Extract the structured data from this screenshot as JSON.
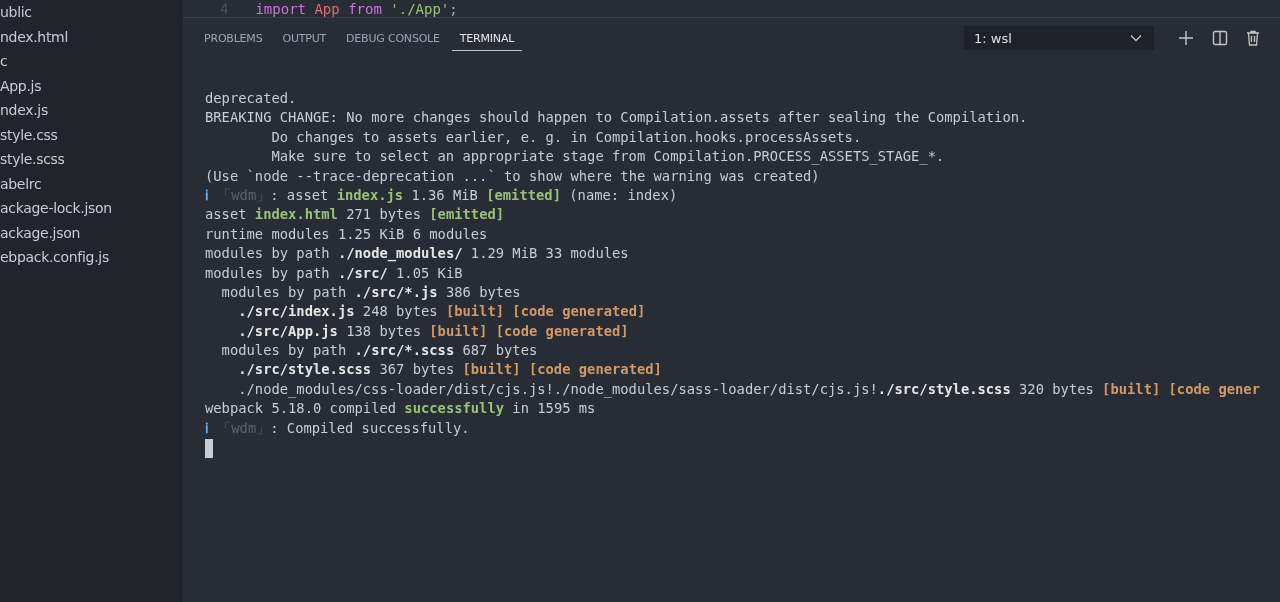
{
  "explorer": {
    "items": [
      "ublic",
      "ndex.html",
      "c",
      "App.js",
      "ndex.js",
      "style.css",
      "style.scss",
      "abelrc",
      "ackage-lock.json",
      "ackage.json",
      "ebpack.config.js"
    ]
  },
  "editor": {
    "line_number": "4",
    "code": [
      {
        "text": "import",
        "kind": "keyword"
      },
      {
        "text": "App",
        "kind": "variable"
      },
      {
        "text": "from",
        "kind": "keyword"
      },
      {
        "text": "'./App'",
        "kind": "string"
      },
      {
        "text": ";",
        "kind": "punctuation"
      }
    ]
  },
  "panel": {
    "tabs": [
      {
        "label": "PROBLEMS",
        "selected": false
      },
      {
        "label": "OUTPUT",
        "selected": false
      },
      {
        "label": "DEBUG CONSOLE",
        "selected": false
      },
      {
        "label": "TERMINAL",
        "selected": true
      }
    ],
    "terminal_select": {
      "value": "1: wsl"
    },
    "terminal": {
      "lines": [
        {
          "kind": "top",
          "segments": [
            {
              "text": "deprecated."
            }
          ]
        },
        {
          "kind": "top",
          "segments": [
            {
              "text": "BREAKING CHANGE: No more changes should happen to Compilation.assets after sealing the Compilation."
            }
          ]
        },
        {
          "kind": "continuation",
          "segments": [
            {
              "text": "Do changes to assets earlier, e. g. in Compilation.hooks.processAssets."
            }
          ]
        },
        {
          "kind": "continuation",
          "segments": [
            {
              "text": "Make sure to select an appropriate stage from Compilation.PROCESS_ASSETS_STAGE_*."
            }
          ]
        },
        {
          "kind": "top",
          "segments": [
            {
              "text": "(Use `node --trace-deprecation ...` to show where the warning was created)"
            }
          ]
        },
        {
          "kind": "top",
          "segments": [
            {
              "text": "ℹ",
              "kind": "info"
            },
            {
              "text": "「wdm」",
              "kind": "logger"
            },
            {
              "text": ": asset "
            },
            {
              "text": "index.js",
              "kind": "file"
            },
            {
              "text": " 1.36 MiB "
            },
            {
              "text": "[emitted]",
              "kind": "status"
            },
            {
              "text": " (name: index)"
            }
          ]
        },
        {
          "kind": "top",
          "segments": [
            {
              "text": "asset "
            },
            {
              "text": "index.html",
              "kind": "file"
            },
            {
              "text": " 271 bytes "
            },
            {
              "text": "[emitted]",
              "kind": "status"
            }
          ]
        },
        {
          "kind": "top",
          "segments": [
            {
              "text": "runtime modules 1.25 KiB 6 modules"
            }
          ]
        },
        {
          "kind": "top",
          "segments": [
            {
              "text": "modules by path "
            },
            {
              "text": "./node_modules/",
              "kind": "path"
            },
            {
              "text": " 1.29 MiB 33 modules"
            }
          ]
        },
        {
          "kind": "top",
          "segments": [
            {
              "text": "modules by path "
            },
            {
              "text": "./src/",
              "kind": "path"
            },
            {
              "text": " 1.05 KiB"
            }
          ]
        },
        {
          "kind": "group",
          "segments": [
            {
              "text": "modules by path "
            },
            {
              "text": "./src/*.js",
              "kind": "path"
            },
            {
              "text": " 386 bytes"
            }
          ]
        },
        {
          "kind": "module",
          "segments": [
            {
              "text": "./src/index.js",
              "kind": "path"
            },
            {
              "text": " 248 bytes "
            },
            {
              "text": "[built] [code generated]",
              "kind": "flag"
            }
          ]
        },
        {
          "kind": "module",
          "segments": [
            {
              "text": "./src/App.js",
              "kind": "path"
            },
            {
              "text": " 138 bytes "
            },
            {
              "text": "[built] [code generated]",
              "kind": "flag"
            }
          ]
        },
        {
          "kind": "group",
          "segments": [
            {
              "text": "modules by path "
            },
            {
              "text": "./src/*.scss",
              "kind": "path"
            },
            {
              "text": " 687 bytes"
            }
          ]
        },
        {
          "kind": "module",
          "segments": [
            {
              "text": "./src/style.scss",
              "kind": "path"
            },
            {
              "text": " 367 bytes "
            },
            {
              "text": "[built] [code generated]",
              "kind": "flag"
            }
          ]
        },
        {
          "kind": "module",
          "segments": [
            {
              "text": "./node_modules/css-loader/dist/cjs.js!./node_modules/sass-loader/dist/cjs.js!"
            },
            {
              "text": "./src/style.scss",
              "kind": "path"
            },
            {
              "text": " 320 bytes "
            },
            {
              "text": "[built] [code gener",
              "kind": "flag"
            }
          ]
        },
        {
          "kind": "top",
          "segments": [
            {
              "text": "webpack 5.18.0 compiled "
            },
            {
              "text": "successfully",
              "kind": "status"
            },
            {
              "text": " in 1595 ms"
            }
          ]
        },
        {
          "kind": "top",
          "segments": [
            {
              "text": "ℹ",
              "kind": "info"
            },
            {
              "text": "「wdm」",
              "kind": "logger"
            },
            {
              "text": ": Compiled successfully."
            }
          ]
        }
      ]
    }
  }
}
